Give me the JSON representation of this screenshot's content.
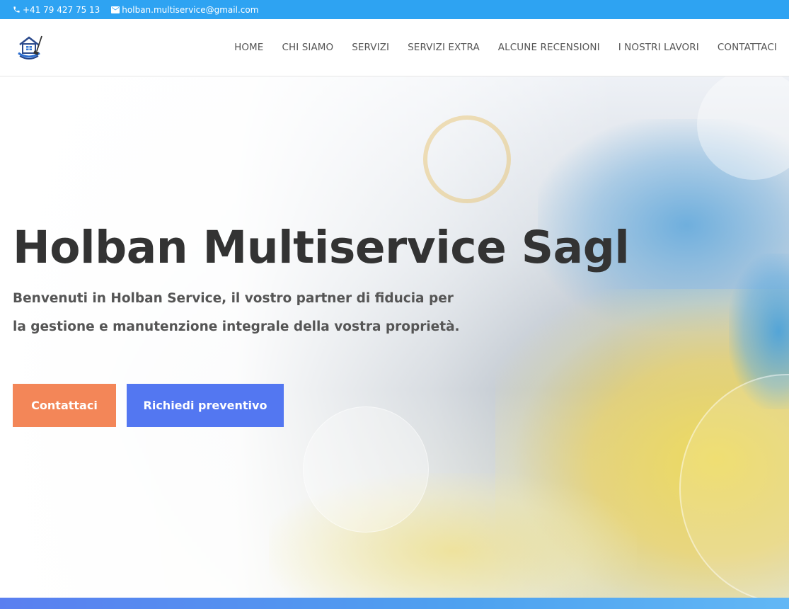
{
  "topbar": {
    "phone": "+41 79 427 75 13",
    "email": "holban.multiservice@gmail.com",
    "phone_icon": "phone-icon",
    "email_icon": "envelope-icon"
  },
  "header": {
    "logo": "house-broom-logo",
    "nav": [
      {
        "label": "HOME"
      },
      {
        "label": "CHI SIAMO"
      },
      {
        "label": "SERVIZI"
      },
      {
        "label": "SERVIZI EXTRA"
      },
      {
        "label": "ALCUNE RECENSIONI"
      },
      {
        "label": "I NOSTRI LAVORI"
      },
      {
        "label": "CONTATTACI"
      }
    ]
  },
  "hero": {
    "title": "Holban Multiservice Sagl",
    "text": "Benvenuti in Holban Service, il vostro partner di fiducia per la gestione e manutenzione integrale della vostra proprietà.",
    "buttons": {
      "contact": "Contattaci",
      "quote": "Richiedi preventivo"
    }
  },
  "colors": {
    "topbar": "#2ea3f2",
    "contact_button": "#f38658",
    "quote_button": "#5377f1",
    "title": "#333333"
  }
}
